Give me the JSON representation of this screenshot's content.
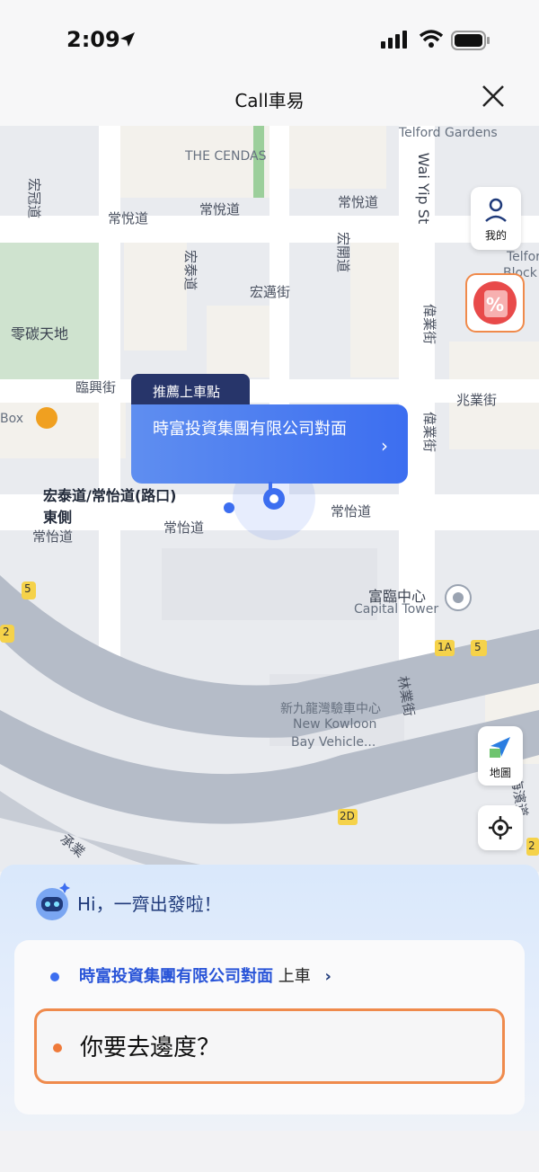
{
  "status": {
    "time": "2:09"
  },
  "nav": {
    "title": "Call車易"
  },
  "map": {
    "labels": {
      "cendas": "THE CENDAS",
      "telford_gardens": "Telford Gardens",
      "telford_g": "Telford Ga",
      "block": "Block A",
      "wai_yip_st": "Wai Yip St",
      "wang_kwun_road": "宏冠道",
      "sheung_yuet_road_1": "常悅道",
      "sheung_yuet_road_2": "常悅道",
      "sheung_yuet_road_3": "常悅道",
      "wang_tai_road": "宏泰道",
      "wang_kee_road": "宏開道",
      "wang_chiu_road": "宏邁街",
      "zero_carbon": "零碳天地",
      "lam_hing_st": "臨興街",
      "box": "Box",
      "wai_yip_jie_1": "偉業街",
      "wai_yip_jie_2": "偉業街",
      "siu_yip_st": "兆業街",
      "sheung_yee_road_1": "常怡道",
      "sheung_yee_road_2": "常怡道",
      "sheung_yee_road_3": "常怡道",
      "richland_centre": "富臨中心",
      "capital_tower": "Capital Tower",
      "new_kowloon_cn": "新九龍灣驗車中心",
      "new_kowloon_en1": "New Kowloon",
      "new_kowloon_en2": "Bay Vehicle...",
      "lam_yip_st": "林業街",
      "hoi_bun_road": "海濱道",
      "road_1a": "1A",
      "road_5a": "5",
      "road_5b": "5",
      "road_2": "2",
      "road_2d": "2D",
      "road_2b": "2",
      "chun_yip": "承業"
    },
    "pickup_tag": "推薦上車點",
    "pickup_card": "時富投資集團有限公司對面",
    "corner_label_line1": "宏泰道/常怡道(路口)",
    "corner_label_line2": "東側",
    "me_button": "我的",
    "map_button": "地圖"
  },
  "sheet": {
    "greeting": "Hi，一齊出發啦！",
    "pickup_place": "時富投資集團有限公司對面",
    "pickup_suffix": "上車",
    "destination_placeholder": "你要去邊度？"
  },
  "colors": {
    "accent_blue": "#3c6ef0",
    "accent_orange": "#ef8a4c",
    "pickup_tag_bg": "#27356a"
  }
}
